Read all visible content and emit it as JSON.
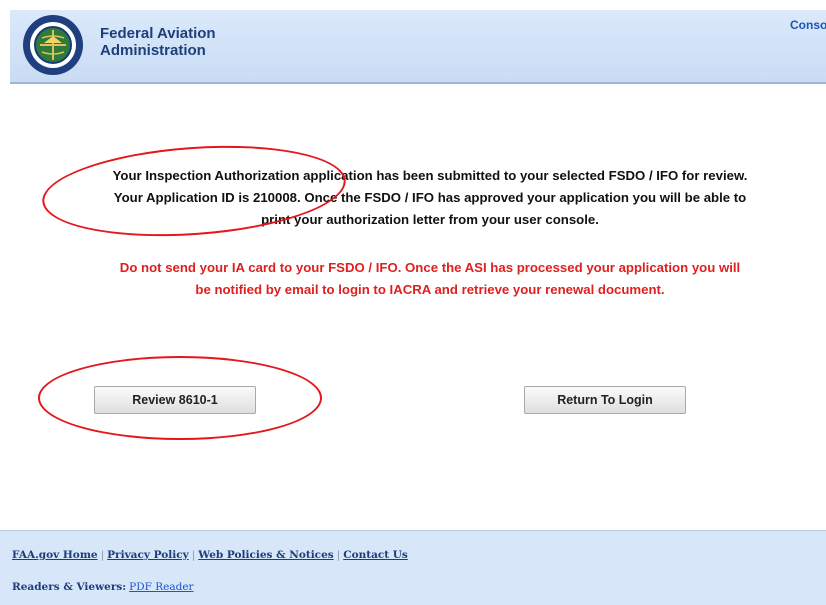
{
  "header": {
    "agency_line1": "Federal Aviation",
    "agency_line2": "Administration",
    "console_link": "Console"
  },
  "main": {
    "message_line1": "Your Inspection Authorization application has been submitted to your selected FSDO / IFO for review.",
    "message_line2": "Your Application ID is 210008. Once the FSDO / IFO has approved your application you will be able to",
    "message_line3": "print your authorization letter from your user console.",
    "warning_line1": "Do not send your IA card to your FSDO / IFO. Once the ASI has processed your application you will",
    "warning_line2": "be notified by email to login to IACRA and retrieve your renewal document.",
    "review_button": "Review 8610-1",
    "return_button": "Return To Login"
  },
  "footer": {
    "links": [
      "FAA.gov Home",
      "Privacy Policy",
      "Web Policies & Notices",
      "Contact Us"
    ],
    "separator": "|",
    "readers_label": "Readers & Viewers:",
    "pdf_reader": "PDF Reader"
  },
  "colors": {
    "header_bg": "#d2e3f8",
    "warning_text": "#e0201f",
    "annotation_circle": "#e3171c",
    "link_blue": "#1d3d7a"
  },
  "icons": {
    "seal": "faa-seal-icon"
  }
}
